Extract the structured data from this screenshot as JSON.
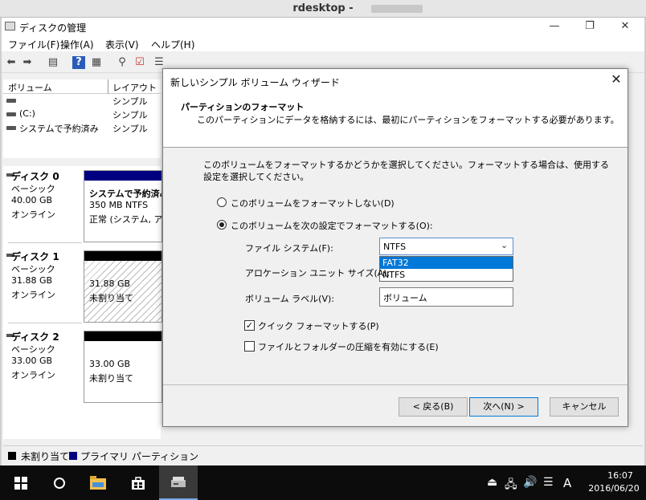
{
  "rdesktop": {
    "title": "rdesktop - "
  },
  "window": {
    "title": "ディスクの管理",
    "minimize": "—",
    "maximize": "❐",
    "close": "✕"
  },
  "menu": [
    "ファイル(F)",
    "操作(A)",
    "表示(V)",
    "ヘルプ(H)"
  ],
  "volume_list": {
    "columns": [
      "ボリューム",
      "レイアウト"
    ],
    "rows": [
      {
        "name": "",
        "layout": "シンプル"
      },
      {
        "name": "(C:)",
        "layout": "シンプル"
      },
      {
        "name": "システムで予約済み",
        "layout": "シンプル"
      }
    ]
  },
  "disks": [
    {
      "name": "ディスク 0",
      "type": "ベーシック",
      "size": "40.00 GB",
      "status": "オンライン",
      "partition": {
        "line1": "システムで予約済み",
        "line2": "350 MB NTFS",
        "line3": "正常 (システム, アクテ",
        "bar_color": "#000080"
      }
    },
    {
      "name": "ディスク 1",
      "type": "ベーシック",
      "size": "31.88 GB",
      "status": "オンライン",
      "partition": {
        "line1": "31.88 GB",
        "line2": "未割り当て",
        "bar_color": "#000000"
      }
    },
    {
      "name": "ディスク 2",
      "type": "ベーシック",
      "size": "33.00 GB",
      "status": "オンライン",
      "partition": {
        "line1": "33.00 GB",
        "line2": "未割り当て",
        "bar_color": "#000000"
      }
    }
  ],
  "legend": [
    {
      "label": "未割り当て",
      "color": "#000000"
    },
    {
      "label": "プライマリ パーティション",
      "color": "#000080"
    }
  ],
  "wizard": {
    "title": "新しいシンプル ボリューム ウィザード",
    "close": "✕",
    "heading": "パーティションのフォーマット",
    "subheading": "このパーティションにデータを格納するには、最初にパーティションをフォーマットする必要があります。",
    "description": "このボリュームをフォーマットするかどうかを選択してください。フォーマットする場合は、使用する設定を選択してください。",
    "radio_no_format": "このボリュームをフォーマットしない(D)",
    "radio_format": "このボリュームを次の設定でフォーマットする(O):",
    "fs_label": "ファイル システム(F):",
    "fs_value": "NTFS",
    "fs_options": [
      "FAT32",
      "NTFS"
    ],
    "alloc_label": "アロケーション ユニット サイズ(A):",
    "vol_label_label": "ボリューム ラベル(V):",
    "vol_label_value": "ボリューム",
    "quick_format": "クイック フォーマットする(P)",
    "compression": "ファイルとフォルダーの圧縮を有効にする(E)",
    "back": "< 戻る(B)",
    "next": "次へ(N) >",
    "cancel": "キャンセル"
  },
  "taskbar": {
    "time": "16:07",
    "date": "2016/06/20",
    "ime": "A"
  }
}
